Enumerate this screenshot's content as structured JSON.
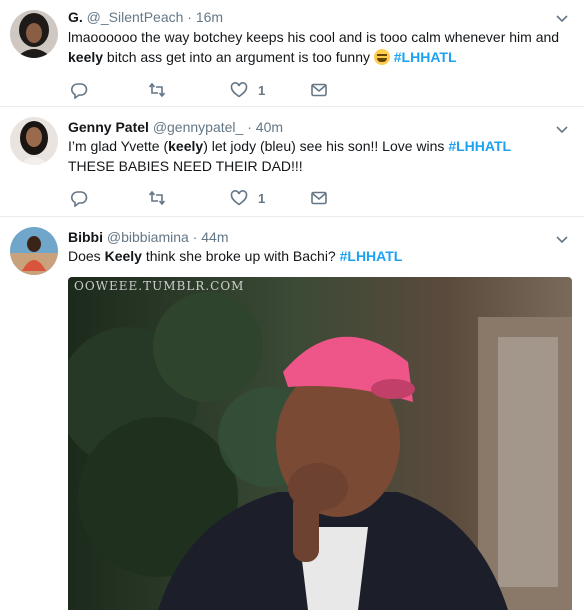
{
  "tweets": [
    {
      "name": "G.",
      "handle": "@_SilentPeach",
      "dot": "·",
      "time": "16m",
      "text_parts": {
        "p1": "lmaoooooo the way botchey keeps his cool and is tooo calm whenever him and",
        "keely": "keely",
        "p2": " bitch ass get into an argument is too funny ",
        "tag": "#LHHATL"
      },
      "emoji": "face-with-tears-of-joy",
      "likes": "1"
    },
    {
      "name": "Genny Patel",
      "handle": "@gennypatel_",
      "dot": "·",
      "time": "40m",
      "text_parts": {
        "p1": "I’m glad Yvette (",
        "keely": "keely",
        "p2": ")  let jody (bleu)  see his son!! Love wins ",
        "tag": "#LHHATL",
        "line2": "THESE BABIES NEED THEIR DAD!!!"
      },
      "likes": "1"
    },
    {
      "name": "Bibbi",
      "handle": "@bibbiamina",
      "dot": "·",
      "time": "44m",
      "text_parts": {
        "p1": "Does ",
        "keely": "Keely",
        "p2": " think she broke up with Bachi? ",
        "tag": "#LHHATL"
      },
      "media_watermark": "OOWEEE.TUMBLR.COM"
    }
  ],
  "colors": {
    "link": "#1da1f2",
    "muted": "#657786",
    "separator": "#e6ecf0",
    "cap": "#ee5588"
  },
  "icons": [
    "reply-icon",
    "retweet-icon",
    "like-icon",
    "dm-icon",
    "chevron-down-icon"
  ]
}
